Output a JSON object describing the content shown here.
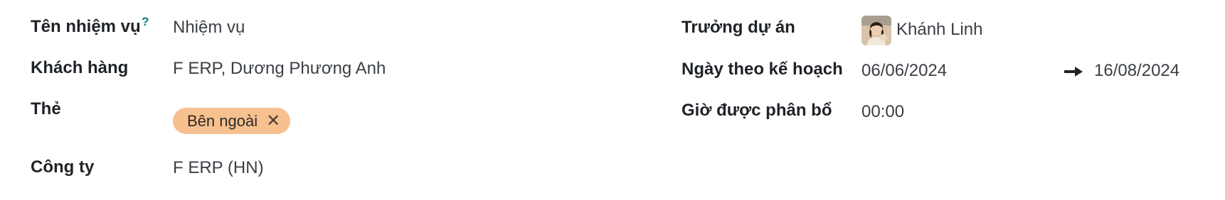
{
  "left": {
    "task_name": {
      "label": "Tên nhiệm vụ",
      "help": "?",
      "value": "Nhiệm vụ",
      "placeholder": ""
    },
    "customer": {
      "label": "Khách hàng",
      "value": "F ERP, Dương Phương Anh"
    },
    "tags": {
      "label": "Thẻ",
      "items": [
        {
          "label": "Bên ngoài",
          "remove": "✕",
          "color": "#f7c08f"
        }
      ]
    },
    "company": {
      "label": "Công ty",
      "value": "F ERP (HN)"
    }
  },
  "right": {
    "project_manager": {
      "label": "Trưởng dự án",
      "value": "Khánh Linh",
      "avatar": "user-avatar"
    },
    "planned_date": {
      "label": "Ngày theo kế hoạch",
      "start": "06/06/2024",
      "arrow_icon": "arrow-right-icon",
      "end": "16/08/2024"
    },
    "allocated_hours": {
      "label": "Giờ được phân bổ",
      "value": "00:00"
    }
  },
  "colors": {
    "accent": "#017e84",
    "tag_background": "#f7c08f",
    "label_text": "#1f2327",
    "value_text": "#3a3f44"
  }
}
